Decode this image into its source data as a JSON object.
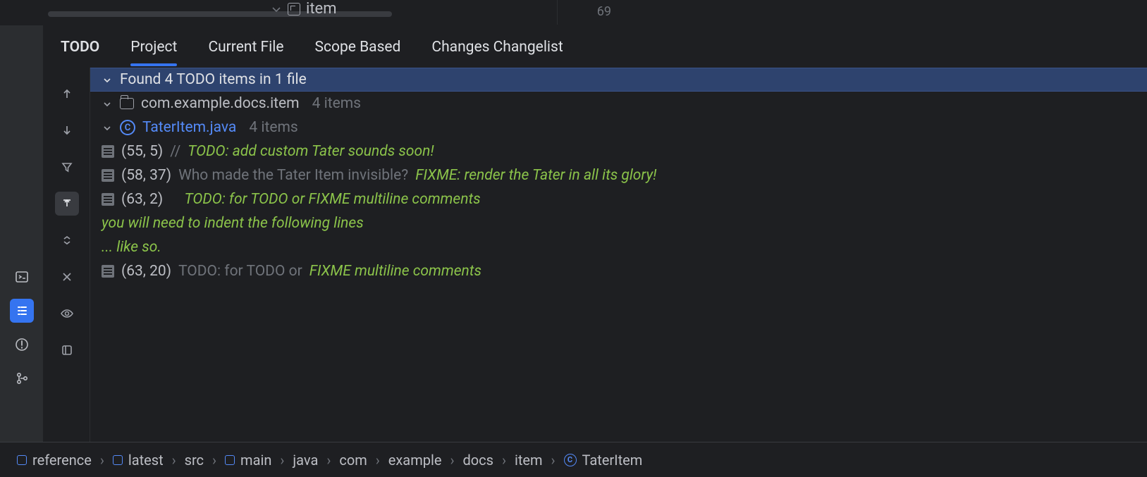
{
  "fileBar": {
    "fileName": "item",
    "lineCol": "69"
  },
  "tabs": {
    "title": "TODO",
    "items": [
      "Project",
      "Current File",
      "Scope Based",
      "Changes Changelist"
    ],
    "activeIndex": 0
  },
  "tree": {
    "summary": "Found 4 TODO items in 1 file",
    "package": {
      "name": "com.example.docs.item",
      "count": "4 items"
    },
    "file": {
      "name": "TaterItem.java",
      "count": "4 items"
    },
    "items": [
      {
        "pos": "(55, 5)",
        "segments": [
          {
            "cls": "dim",
            "text": "// "
          },
          {
            "cls": "todo",
            "text": "TODO: add custom Tater sounds soon!"
          }
        ]
      },
      {
        "pos": "(58, 37)",
        "segments": [
          {
            "cls": "plain",
            "text": "Who made the Tater Item invisible? "
          },
          {
            "cls": "fixme",
            "text": "FIXME: render the Tater in all its glory!"
          }
        ]
      },
      {
        "pos": "(63, 2)",
        "segments": [
          {
            "cls": "todo",
            "text": "    TODO: for TODO or FIXME multiline comments"
          }
        ],
        "continuation": [
          "you will need to indent the following lines",
          "... like so."
        ]
      },
      {
        "pos": "(63, 20)",
        "segments": [
          {
            "cls": "plain",
            "text": "TODO: for TODO or "
          },
          {
            "cls": "fixme",
            "text": "FIXME multiline comments"
          }
        ]
      }
    ]
  },
  "breadcrumbs": [
    {
      "icon": "sq",
      "label": "reference"
    },
    {
      "icon": "sq",
      "label": "latest"
    },
    {
      "icon": "",
      "label": "src"
    },
    {
      "icon": "sq",
      "label": "main"
    },
    {
      "icon": "",
      "label": "java"
    },
    {
      "icon": "",
      "label": "com"
    },
    {
      "icon": "",
      "label": "example"
    },
    {
      "icon": "",
      "label": "docs"
    },
    {
      "icon": "",
      "label": "item"
    },
    {
      "icon": "circ",
      "label": "TaterItem"
    }
  ],
  "gutterIcons": [
    "arrow-up",
    "arrow-down",
    "funnel",
    "expand",
    "sort",
    "close",
    "eye",
    "layout"
  ],
  "stripIcons": [
    "terminal",
    "list",
    "alert",
    "vcs"
  ]
}
